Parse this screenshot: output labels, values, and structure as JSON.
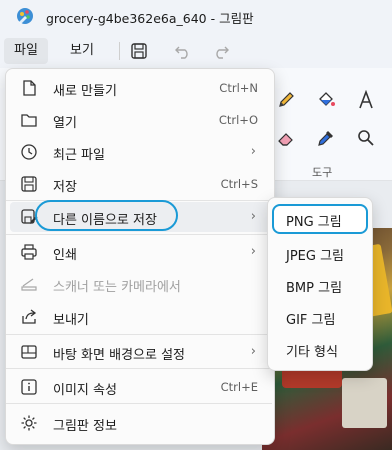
{
  "window": {
    "title": "grocery-g4be362e6a_640 - 그림판"
  },
  "menubar": {
    "file": "파일",
    "view": "보기"
  },
  "ribbon": {
    "group_label": "도구"
  },
  "file_menu": {
    "items": [
      {
        "label": "새로 만들기",
        "shortcut": "Ctrl+N"
      },
      {
        "label": "열기",
        "shortcut": "Ctrl+O"
      },
      {
        "label": "최근 파일",
        "shortcut": ""
      },
      {
        "label": "저장",
        "shortcut": "Ctrl+S"
      },
      {
        "label": "다른 이름으로 저장",
        "shortcut": ""
      },
      {
        "label": "인쇄",
        "shortcut": ""
      },
      {
        "label": "스캐너 또는 카메라에서",
        "shortcut": ""
      },
      {
        "label": "보내기",
        "shortcut": ""
      },
      {
        "label": "바탕 화면 배경으로 설정",
        "shortcut": ""
      },
      {
        "label": "이미지 속성",
        "shortcut": "Ctrl+E"
      },
      {
        "label": "그림판 정보",
        "shortcut": ""
      }
    ],
    "chevron": "›"
  },
  "save_as_submenu": {
    "items": [
      {
        "label": "PNG 그림"
      },
      {
        "label": "JPEG 그림"
      },
      {
        "label": "BMP 그림"
      },
      {
        "label": "GIF 그림"
      },
      {
        "label": "기타 형식"
      }
    ]
  },
  "colors": {
    "accent": "#1a9ad6"
  }
}
